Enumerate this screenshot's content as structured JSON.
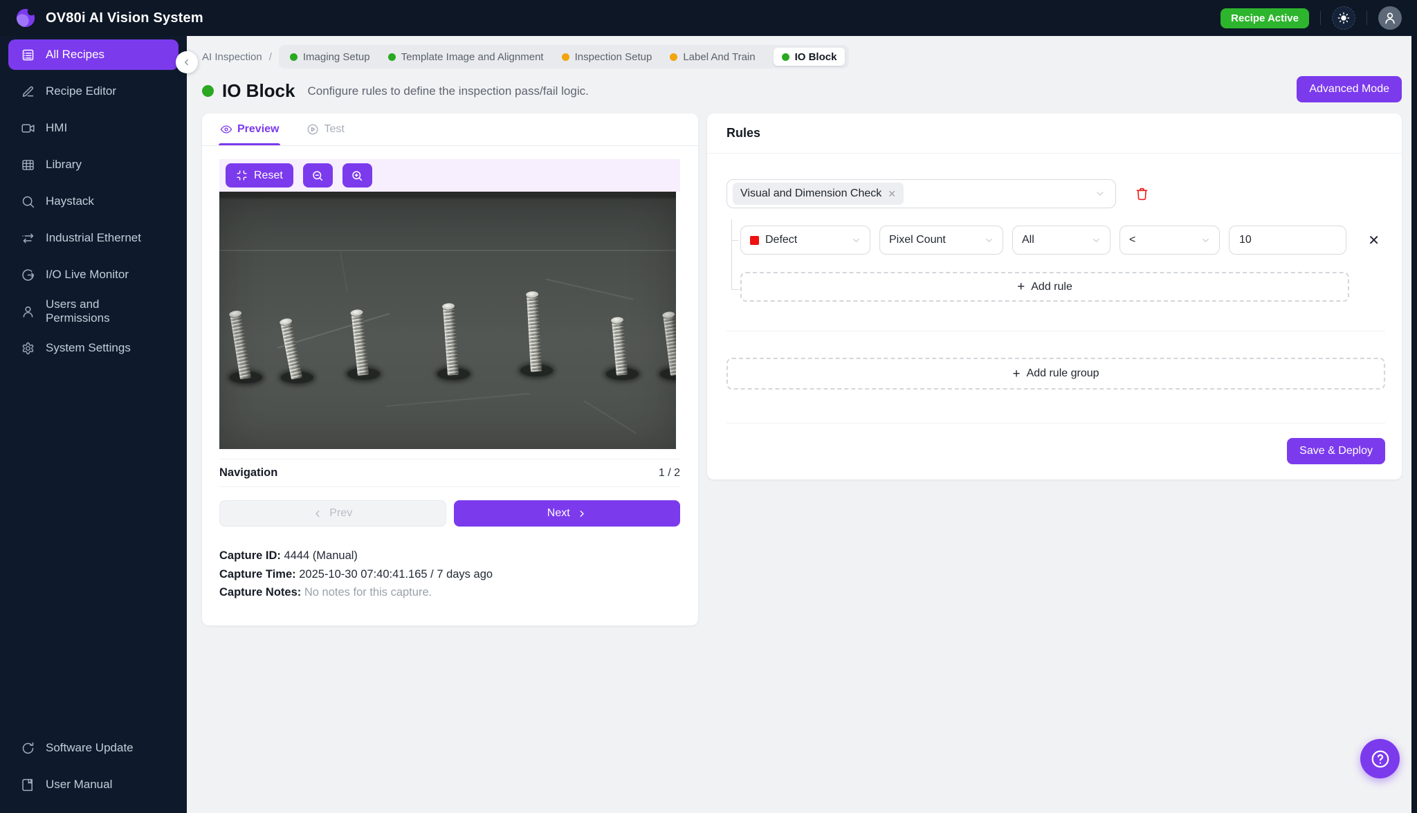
{
  "topbar": {
    "title": "OV80i AI Vision System",
    "badge": "Recipe Active"
  },
  "sidebar": {
    "items": [
      {
        "label": "All Recipes",
        "icon": "recipes-icon",
        "active": true
      },
      {
        "label": "Recipe Editor",
        "icon": "pencil-icon"
      },
      {
        "label": "HMI",
        "icon": "video-icon"
      },
      {
        "label": "Library",
        "icon": "grid-icon"
      },
      {
        "label": "Haystack",
        "icon": "search-icon"
      },
      {
        "label": "Industrial Ethernet",
        "icon": "swap-arrows-icon"
      },
      {
        "label": "I/O Live Monitor",
        "icon": "io-monitor-icon"
      },
      {
        "label": "Users and Permissions",
        "icon": "user-icon"
      },
      {
        "label": "System Settings",
        "icon": "gear-icon"
      }
    ],
    "footer_items": [
      {
        "label": "Software Update",
        "icon": "refresh-icon"
      },
      {
        "label": "User Manual",
        "icon": "book-icon"
      }
    ]
  },
  "breadcrumb": {
    "root": "AI Inspection",
    "separator": "/",
    "steps": [
      {
        "label": "Imaging Setup",
        "color": "#2aa821"
      },
      {
        "label": "Template Image and Alignment",
        "color": "#2aa821"
      },
      {
        "label": "Inspection Setup",
        "color": "#f2a50c"
      },
      {
        "label": "Label And Train",
        "color": "#f2a50c"
      },
      {
        "label": "IO Block",
        "color": "#2aa821",
        "active": true
      }
    ]
  },
  "page": {
    "status_color": "#2aa821",
    "title": "IO Block",
    "subtitle": "Configure rules to define the inspection pass/fail logic.",
    "advanced_mode_label": "Advanced Mode"
  },
  "preview": {
    "tabs": [
      {
        "label": "Preview"
      },
      {
        "label": "Test"
      }
    ],
    "reset_label": "Reset",
    "image_alt": "Grayscale close-up photo of seven threaded screws standing upright in holes of a scratched dark metal plate",
    "navigation_label": "Navigation",
    "page_indicator": "1 / 2",
    "prev_label": "Prev",
    "next_label": "Next",
    "capture": {
      "id_label": "Capture ID:",
      "id_value": "4444 (Manual)",
      "time_label": "Capture Time:",
      "time_value": "2025-10-30 07:40:41.165 / 7 days ago",
      "notes_label": "Capture Notes:",
      "notes_value": "No notes for this capture."
    }
  },
  "rules": {
    "title": "Rules",
    "check_tag": "Visual and Dimension Check",
    "rule": {
      "class": "Defect",
      "class_color": "#ee1111",
      "metric": "Pixel Count",
      "scope": "All",
      "operator": "<",
      "value": "10"
    },
    "add_rule_label": "Add rule",
    "add_rule_group_label": "Add rule group",
    "save_label": "Save & Deploy"
  },
  "help": {
    "label": "?"
  },
  "colors": {
    "accent": "#7c3aed",
    "badge_green": "#2db52d",
    "danger": "#ef2020",
    "topbar": "#0d1726"
  }
}
